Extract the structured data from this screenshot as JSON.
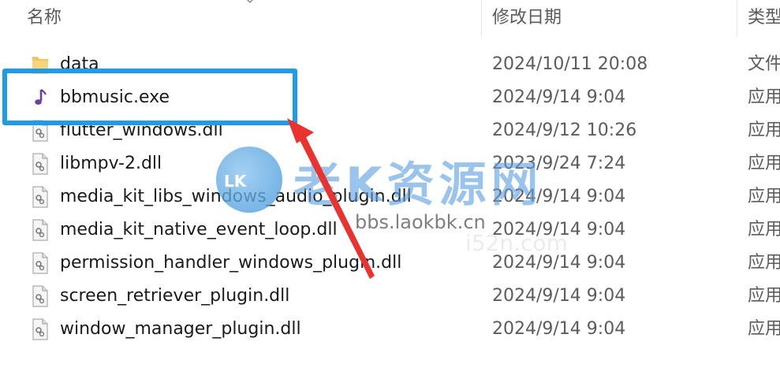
{
  "columns": {
    "name": "名称",
    "date": "修改日期",
    "type": "类型"
  },
  "files": [
    {
      "name": "data",
      "date": "2024/10/11 20:08",
      "type": "文件",
      "icon": "folder-icon"
    },
    {
      "name": "bbmusic.exe",
      "date": "2024/9/14 9:04",
      "type": "应用",
      "icon": "music-note-icon"
    },
    {
      "name": "flutter_windows.dll",
      "date": "2024/9/12 10:26",
      "type": "应用",
      "icon": "dll-file-icon"
    },
    {
      "name": "libmpv-2.dll",
      "date": "2023/9/24 7:24",
      "type": "应用",
      "icon": "dll-file-icon"
    },
    {
      "name": "media_kit_libs_windows_audio_plugin.dll",
      "date": "2024/9/14 9:04",
      "type": "应用",
      "icon": "dll-file-icon"
    },
    {
      "name": "media_kit_native_event_loop.dll",
      "date": "2024/9/14 9:04",
      "type": "应用",
      "icon": "dll-file-icon"
    },
    {
      "name": "permission_handler_windows_plugin.dll",
      "date": "2024/9/14 9:04",
      "type": "应用",
      "icon": "dll-file-icon"
    },
    {
      "name": "screen_retriever_plugin.dll",
      "date": "2024/9/14 9:04",
      "type": "应用",
      "icon": "dll-file-icon"
    },
    {
      "name": "window_manager_plugin.dll",
      "date": "2024/9/14 9:04",
      "type": "应用",
      "icon": "dll-file-icon"
    }
  ],
  "watermark": {
    "logo_text": "LK",
    "title": "老K资源网",
    "url": "bbs.laokbk.cn",
    "url2": "i52n.com"
  },
  "colors": {
    "highlight": "#1e9bea",
    "arrow": "#e8332e",
    "folder": "#f2c45a",
    "music_icon": "#6b3fa0"
  }
}
